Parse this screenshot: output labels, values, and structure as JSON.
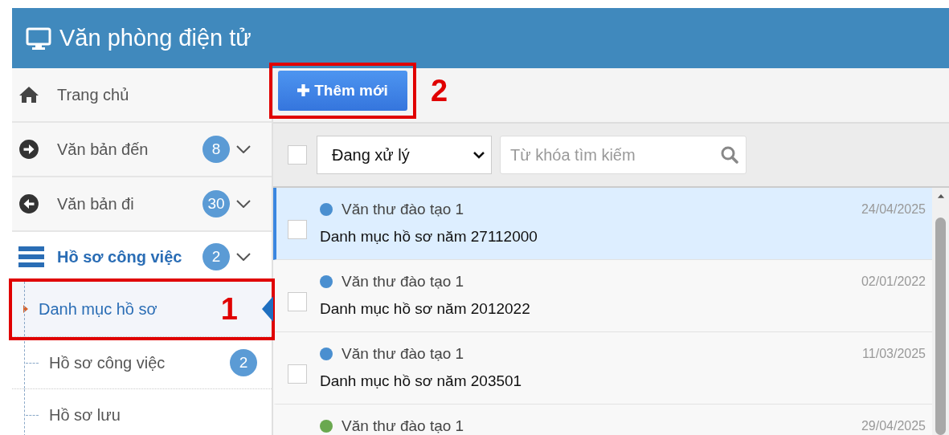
{
  "header": {
    "title": "Văn phòng điện tử"
  },
  "sidebar": {
    "items": [
      {
        "label": "Trang chủ",
        "selected": false
      },
      {
        "label": "Văn bản đến",
        "badge": "8",
        "selected": false
      },
      {
        "label": "Văn bản đi",
        "badge": "30",
        "selected": false
      },
      {
        "label": "Hồ sơ công việc",
        "badge": "2",
        "selected": true,
        "children": [
          {
            "label": "Danh mục hồ sơ",
            "selected": true,
            "annotation": "1"
          },
          {
            "label": "Hồ sơ công việc",
            "badge": "2",
            "selected": false
          },
          {
            "label": "Hồ sơ lưu",
            "selected": false
          }
        ]
      }
    ]
  },
  "toolbar": {
    "add_button": {
      "label": "Thêm mới",
      "annotation": "2"
    }
  },
  "filter": {
    "select_all_checked": false,
    "status": "Đang xử lý",
    "search": {
      "placeholder": "Từ khóa tìm kiếm"
    }
  },
  "list": {
    "rows": [
      {
        "sender": "Văn thư đào tạo 1",
        "date": "24/04/2025",
        "title": "Danh mục hồ sơ năm 27112000",
        "color": "#4a8fd0",
        "selected": true,
        "checked": false
      },
      {
        "sender": "Văn thư đào tạo 1",
        "date": "02/01/2022",
        "title": "Danh mục hồ sơ năm 2012022",
        "color": "#4a8fd0",
        "selected": false,
        "checked": false
      },
      {
        "sender": "Văn thư đào tạo 1",
        "date": "11/03/2025",
        "title": "Danh mục hồ sơ năm 203501",
        "color": "#4a8fd0",
        "selected": false,
        "checked": false
      },
      {
        "sender": "Văn thư đào tạo 1",
        "date": "29/04/2025",
        "color": "#6aa84f",
        "selected": false
      }
    ]
  }
}
